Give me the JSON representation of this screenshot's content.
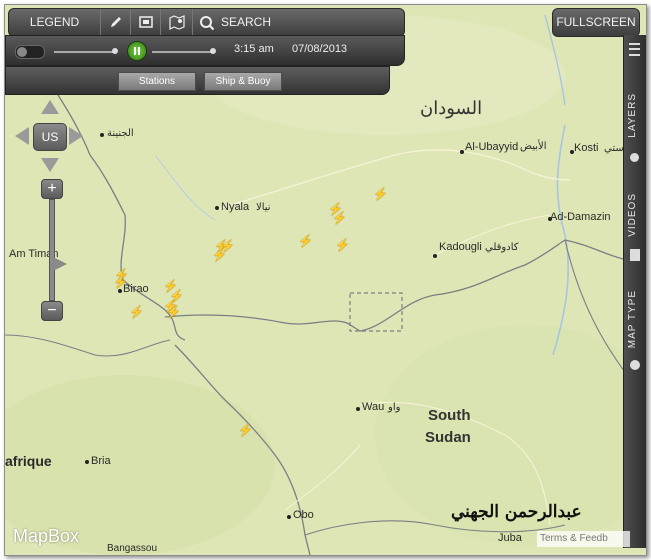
{
  "toolbar": {
    "legend": "LEGEND",
    "search": "SEARCH",
    "fullscreen": "FULLSCREEN"
  },
  "timebar": {
    "time": "3:15 am",
    "date": "07/08/2013"
  },
  "tabs": [
    "Stations",
    "Ship & Buoy"
  ],
  "sidebar": {
    "layers": "LAYERS",
    "videos": "VIDEOS",
    "map_type": "MAP TYPE"
  },
  "nav": {
    "region": "US"
  },
  "map": {
    "labels": {
      "sudan_ar": "السودان",
      "south_sudan_1": "South",
      "south_sudan_2": "Sudan",
      "al_ubayyid": "Al-Ubayyid",
      "al_ubayyid_ar": "الأبيض",
      "kosti": "Kosti",
      "kosti_ar": "كوستي",
      "ad_damazin": "Ad-Damazin",
      "kadougli": "Kadougli",
      "kadougli_ar": "كادوقلي",
      "nyala": "Nyala",
      "nyala_ar": "نيالا",
      "geneina_ar": "الجنينة",
      "am_timan": "Am Timan",
      "birao": "Birao",
      "wau": "Wau",
      "wau_ar": "واو",
      "centrafrique": "afrique",
      "bria": "Bria",
      "obo": "Obo",
      "juba": "Juba",
      "bangassou": "Bangassou"
    },
    "lightning_strikes": 17
  },
  "attribution": {
    "brand": "MapBox",
    "terms": "Terms & Feedb"
  },
  "watermark": "عبدالرحمن الجهني",
  "colors": {
    "land": "#dfe6b5",
    "border": "#7a7f84",
    "river": "#9fc3e0",
    "lightning": "#e4b400",
    "ui_dark": "#3d3d3d"
  }
}
